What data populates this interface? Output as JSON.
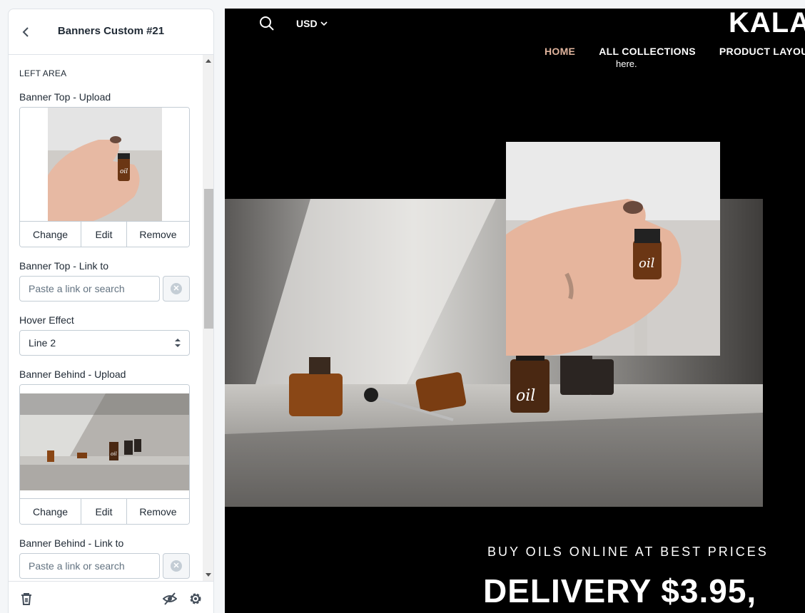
{
  "panel": {
    "title": "Banners Custom #21",
    "section_heading": "LEFT AREA",
    "banner_top": {
      "upload_label": "Banner Top - Upload",
      "change": "Change",
      "edit": "Edit",
      "remove": "Remove",
      "link_label": "Banner Top - Link to",
      "link_placeholder": "Paste a link or search"
    },
    "hover_effect": {
      "label": "Hover Effect",
      "value": "Line 2"
    },
    "banner_behind": {
      "upload_label": "Banner Behind - Upload",
      "change": "Change",
      "edit": "Edit",
      "remove": "Remove",
      "link_label": "Banner Behind - Link to",
      "link_placeholder": "Paste a link or search"
    },
    "footer_icons": [
      "trash-icon",
      "eye-off-icon",
      "gear-icon"
    ]
  },
  "store": {
    "currency": "USD",
    "logo": "KALA",
    "nav": [
      "HOME",
      "ALL COLLECTIONS",
      "PRODUCT LAYOU"
    ],
    "peek_text": "here.",
    "subtitle": "BUY OILS ONLINE AT BEST PRICES",
    "headline": "DELIVERY $3.95,"
  },
  "colors": {
    "nav_active": "#e0b49d",
    "store_background": "#000000",
    "panel_border": "#dfe3e8"
  }
}
